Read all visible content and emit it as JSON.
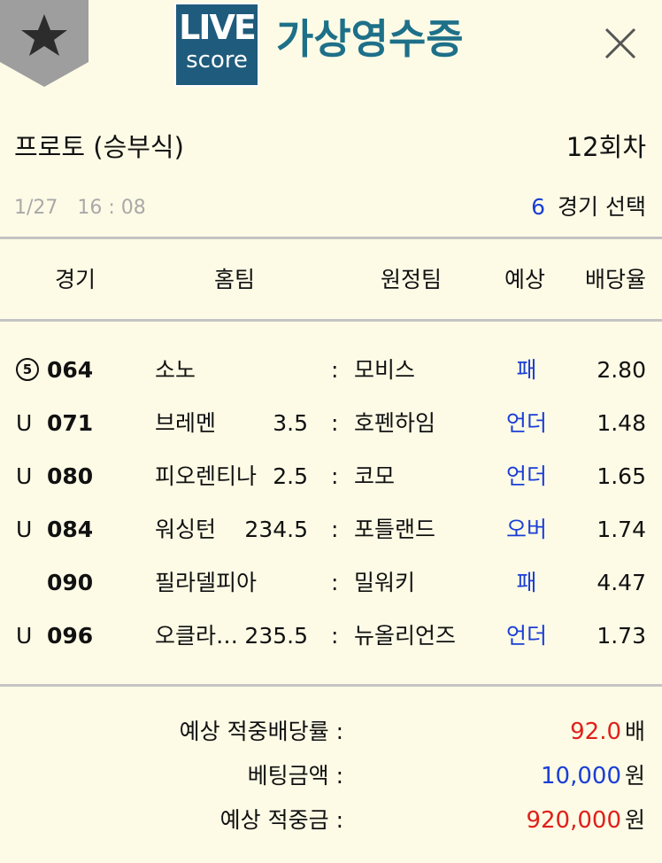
{
  "header": {
    "logo_top": "LIVE",
    "logo_bottom": "score",
    "title": "가상영수증"
  },
  "info": {
    "game_type": "프로토 (승부식)",
    "round": "12회차",
    "date": "1/27",
    "time": "16 : 08",
    "selected_count": "6",
    "selected_label": "경기 선택"
  },
  "columns": {
    "game": "경기",
    "home": "홈팀",
    "away": "원정팀",
    "prediction": "예상",
    "odds": "배당율"
  },
  "rows": [
    {
      "mark": "5",
      "mark_type": "circled",
      "no": "064",
      "home": "소노",
      "handicap": "",
      "sep": ":",
      "away": "모비스",
      "prediction": "패",
      "odds": "2.80"
    },
    {
      "mark": "U",
      "mark_type": "letter",
      "no": "071",
      "home": "브레멘",
      "handicap": "3.5",
      "sep": ":",
      "away": "호펜하임",
      "prediction": "언더",
      "odds": "1.48"
    },
    {
      "mark": "U",
      "mark_type": "letter",
      "no": "080",
      "home": "피오렌티나",
      "handicap": "2.5",
      "sep": ":",
      "away": "코모",
      "prediction": "언더",
      "odds": "1.65"
    },
    {
      "mark": "U",
      "mark_type": "letter",
      "no": "084",
      "home": "워싱턴",
      "handicap": "234.5",
      "sep": ":",
      "away": "포틀랜드",
      "prediction": "오버",
      "odds": "1.74"
    },
    {
      "mark": "",
      "mark_type": "none",
      "no": "090",
      "home": "필라델피아",
      "handicap": "",
      "sep": ":",
      "away": "밀워키",
      "prediction": "패",
      "odds": "4.47"
    },
    {
      "mark": "U",
      "mark_type": "letter",
      "no": "096",
      "home": "오클라…",
      "handicap": "235.5",
      "sep": ":",
      "away": "뉴올리언즈",
      "prediction": "언더",
      "odds": "1.73"
    }
  ],
  "summary": {
    "expected_odds_label": "예상 적중배당률 :",
    "expected_odds_value": "92.0",
    "expected_odds_unit": "배",
    "bet_amount_label": "베팅금액 :",
    "bet_amount_value": "10,000",
    "bet_amount_unit": "원",
    "expected_win_label": "예상 적중금 :",
    "expected_win_value": "920,000",
    "expected_win_unit": "원"
  },
  "colors": {
    "background": "#fdfbe6",
    "title": "#1e7089",
    "logo": "#1f5b7c",
    "accent_blue": "#1a3ed6",
    "accent_red": "#e0201b",
    "bookmark": "#9e9e9e"
  },
  "icons": {
    "bookmark": "star-bookmark-icon",
    "close": "close-icon"
  }
}
